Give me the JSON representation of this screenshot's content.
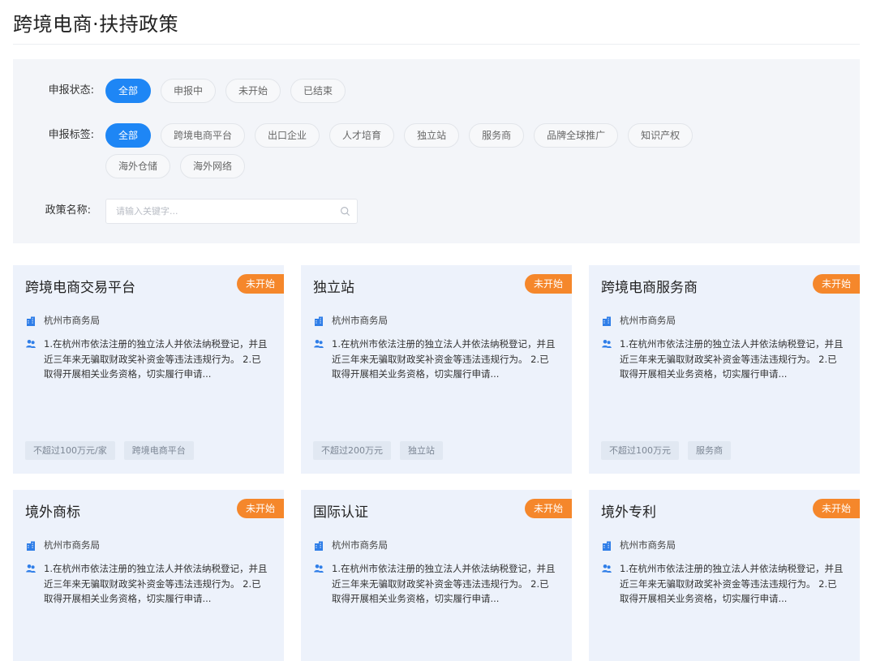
{
  "page": {
    "title": "跨境电商·扶持政策"
  },
  "filters": {
    "status": {
      "label": "申报状态:",
      "options": [
        "全部",
        "申报中",
        "未开始",
        "已结束"
      ],
      "selected": "全部"
    },
    "tags": {
      "label": "申报标签:",
      "options": [
        "全部",
        "跨境电商平台",
        "出口企业",
        "人才培育",
        "独立站",
        "服务商",
        "品牌全球推广",
        "知识产权",
        "海外仓储",
        "海外网络"
      ],
      "selected": "全部"
    },
    "name": {
      "label": "政策名称:",
      "placeholder": "请输入关键字...",
      "value": ""
    }
  },
  "cards": [
    {
      "title": "跨境电商交易平台",
      "badge": "未开始",
      "agency": "杭州市商务局",
      "description": "1.在杭州市依法注册的独立法人并依法纳税登记，并且近三年来无骗取财政奖补资金等违法违规行为。 2.已取得开展相关业务资格，切实履行申请...",
      "tags": [
        "不超过100万元/家",
        "跨境电商平台"
      ]
    },
    {
      "title": "独立站",
      "badge": "未开始",
      "agency": "杭州市商务局",
      "description": "1.在杭州市依法注册的独立法人并依法纳税登记，并且近三年来无骗取财政奖补资金等违法违规行为。 2.已取得开展相关业务资格，切实履行申请...",
      "tags": [
        "不超过200万元",
        "独立站"
      ]
    },
    {
      "title": "跨境电商服务商",
      "badge": "未开始",
      "agency": "杭州市商务局",
      "description": "1.在杭州市依法注册的独立法人并依法纳税登记，并且近三年来无骗取财政奖补资金等违法违规行为。 2.已取得开展相关业务资格，切实履行申请...",
      "tags": [
        "不超过100万元",
        "服务商"
      ]
    },
    {
      "title": "境外商标",
      "badge": "未开始",
      "agency": "杭州市商务局",
      "description": "1.在杭州市依法注册的独立法人并依法纳税登记，并且近三年来无骗取财政奖补资金等违法违规行为。 2.已取得开展相关业务资格，切实履行申请...",
      "tags": []
    },
    {
      "title": "国际认证",
      "badge": "未开始",
      "agency": "杭州市商务局",
      "description": "1.在杭州市依法注册的独立法人并依法纳税登记，并且近三年来无骗取财政奖补资金等违法违规行为。 2.已取得开展相关业务资格，切实履行申请...",
      "tags": []
    },
    {
      "title": "境外专利",
      "badge": "未开始",
      "agency": "杭州市商务局",
      "description": "1.在杭州市依法注册的独立法人并依法纳税登记，并且近三年来无骗取财政奖补资金等违法违规行为。 2.已取得开展相关业务资格，切实履行申请...",
      "tags": []
    }
  ],
  "icons": {
    "agency": "building-icon",
    "requirement": "users-icon",
    "search": "search-icon"
  },
  "colors": {
    "accent": "#1e86f5",
    "badge": "#f5872b",
    "card_bg": "#edf2fb",
    "panel_bg": "#f3f5f9"
  }
}
